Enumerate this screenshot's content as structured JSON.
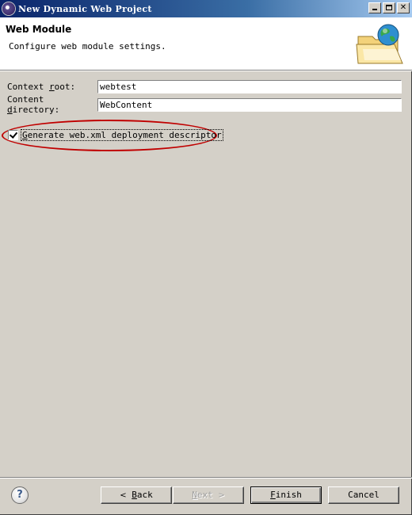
{
  "window": {
    "title": "New Dynamic Web Project",
    "icon": "eclipse-icon"
  },
  "banner": {
    "title": "Web Module",
    "description": "Configure web module settings.",
    "icon": "folder-globe-icon"
  },
  "form": {
    "context_root": {
      "label_prefix": "Context ",
      "label_mnemonic": "r",
      "label_suffix": "oot:",
      "value": "webtest"
    },
    "content_directory": {
      "label_prefix": "Content ",
      "label_mnemonic": "d",
      "label_suffix": "irectory:",
      "value": "WebContent"
    },
    "generate_descriptor": {
      "label_mnemonic": "G",
      "label_rest": "enerate web.xml deployment descriptor",
      "checked": true
    }
  },
  "buttons": {
    "help": "?",
    "back": {
      "arrow": "<",
      "mnemonic": "B",
      "rest": "ack"
    },
    "next": {
      "mnemonic": "N",
      "rest": "ext",
      "arrow": ">"
    },
    "finish": {
      "mnemonic": "F",
      "rest": "inish"
    },
    "cancel": "Cancel"
  },
  "colors": {
    "titlebar_start": "#0a246a",
    "titlebar_end": "#a6caf0",
    "dialog_bg": "#d4d0c8",
    "highlight_ellipse": "#c00000"
  }
}
